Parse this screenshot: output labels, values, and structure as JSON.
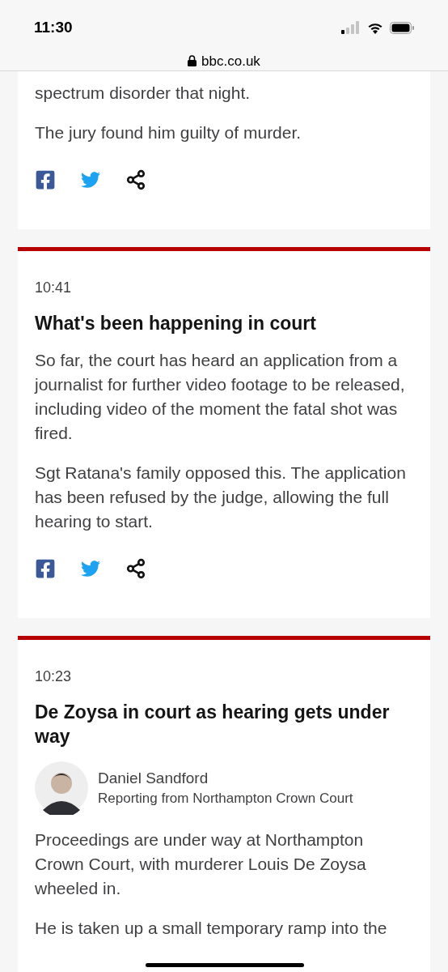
{
  "status_bar": {
    "time": "11:30"
  },
  "address_bar": {
    "url": "bbc.co.uk"
  },
  "posts": [
    {
      "paragraphs": [
        "spectrum disorder that night.",
        "The jury found him guilty of murder."
      ],
      "share": true
    },
    {
      "time": "10:41",
      "heading": "What's been happening in court",
      "paragraphs": [
        "So far, the court has heard an application from a journalist for further video footage to be released, including video of the moment the fatal shot was fired.",
        "Sgt Ratana's family opposed this. The application has been refused by the judge, allowing the full hearing to start."
      ],
      "share": true
    },
    {
      "time": "10:23",
      "heading": "De Zoysa in court as hearing gets under way",
      "author": {
        "name": "Daniel Sandford",
        "role": "Reporting from Northampton Crown Court"
      },
      "paragraphs": [
        "Proceedings are under way at Northampton Crown Court, with murderer Louis De Zoysa wheeled in.",
        "He is taken up a small temporary ramp into the"
      ]
    }
  ]
}
